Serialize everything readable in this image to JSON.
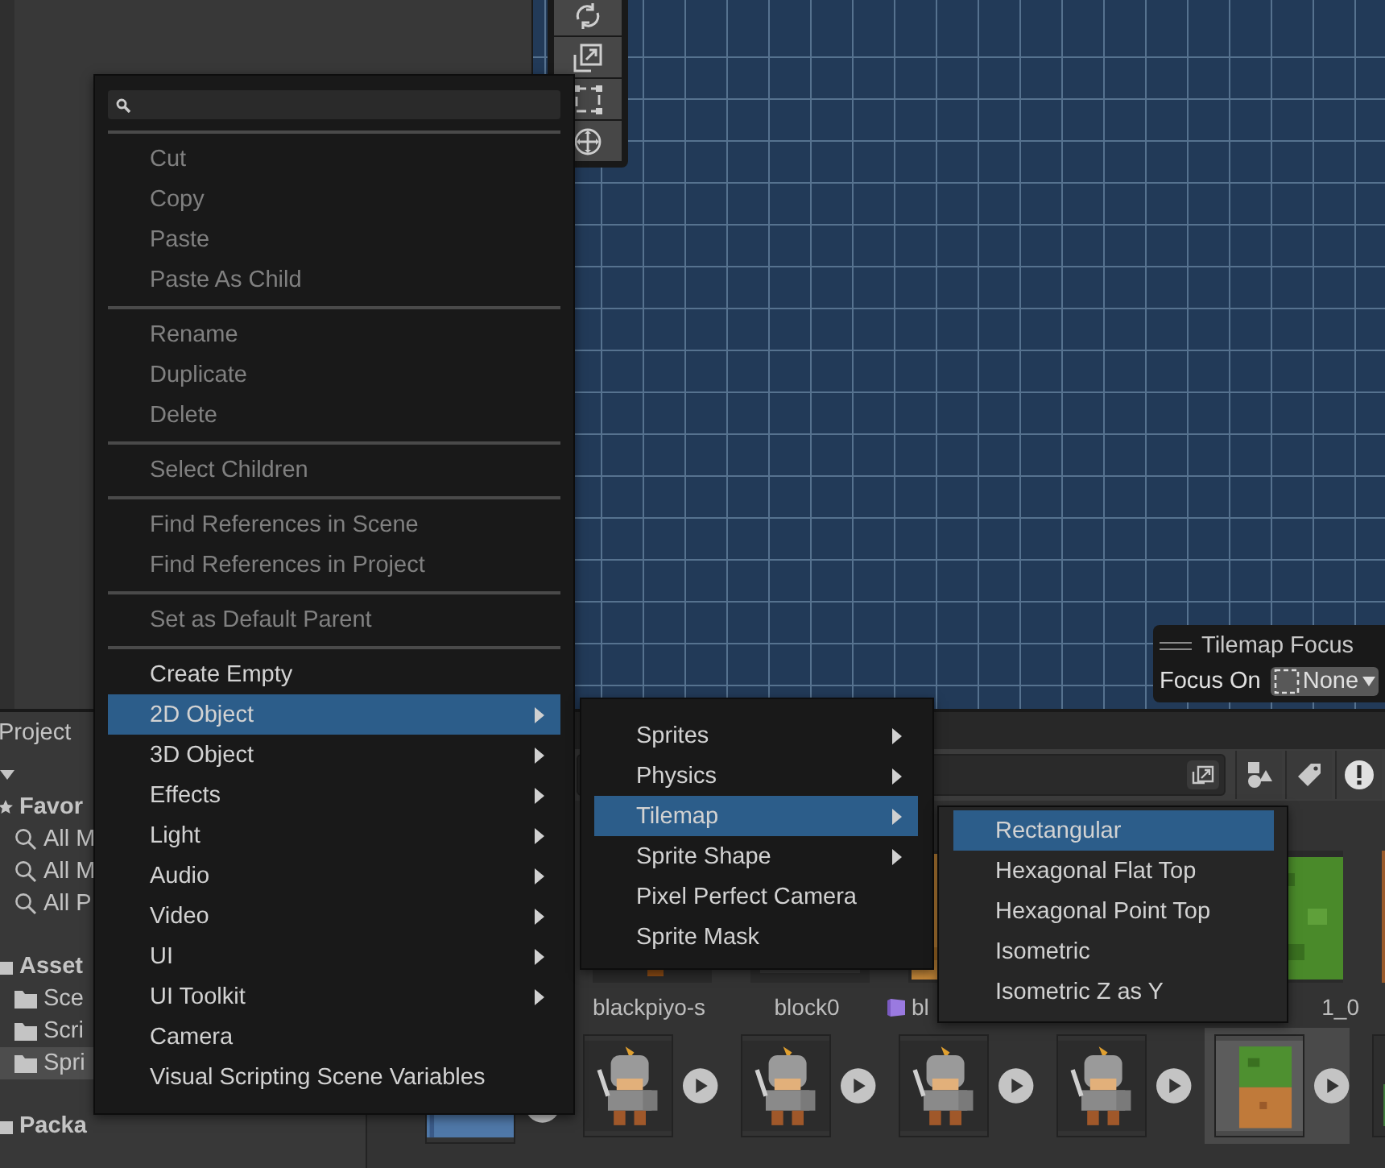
{
  "tilemap_focus": {
    "title": "Tilemap Focus",
    "label": "Focus On",
    "value": "None"
  },
  "project_panel": {
    "title": "Project",
    "tree": [
      {
        "label": "Favor",
        "kind": "favorites",
        "selected": false,
        "children": [
          {
            "label": "All M",
            "kind": "search",
            "selected": false
          },
          {
            "label": "All M",
            "kind": "search",
            "selected": false
          },
          {
            "label": "All P",
            "kind": "search",
            "selected": false
          }
        ]
      },
      {
        "label": "Asset",
        "kind": "folder",
        "selected": false,
        "children": [
          {
            "label": "Sce",
            "kind": "folder",
            "selected": false
          },
          {
            "label": "Scri",
            "kind": "folder",
            "selected": false
          },
          {
            "label": "Spri",
            "kind": "folder",
            "selected": true
          }
        ]
      },
      {
        "label": "Packa",
        "kind": "folder",
        "selected": false
      }
    ],
    "assets_row_1": [
      {
        "label": "blackpiyo-s",
        "kind": "sprite"
      },
      {
        "label": "block0",
        "kind": "sprite"
      },
      {
        "label": "bl",
        "kind": "prefab"
      },
      {
        "label": "1_0",
        "kind": "sprite"
      }
    ],
    "assets_row_2": [
      {
        "selected": false
      },
      {
        "selected": false
      },
      {
        "selected": false
      },
      {
        "selected": false
      },
      {
        "selected": false
      },
      {
        "selected": true
      },
      {
        "selected": false
      }
    ]
  },
  "context_menu": {
    "groups": [
      [
        {
          "label": "Cut",
          "disabled": true,
          "submenu": false,
          "selected": false
        },
        {
          "label": "Copy",
          "disabled": true,
          "submenu": false,
          "selected": false
        },
        {
          "label": "Paste",
          "disabled": true,
          "submenu": false,
          "selected": false
        },
        {
          "label": "Paste As Child",
          "disabled": true,
          "submenu": false,
          "selected": false
        }
      ],
      [
        {
          "label": "Rename",
          "disabled": true,
          "submenu": false,
          "selected": false
        },
        {
          "label": "Duplicate",
          "disabled": true,
          "submenu": false,
          "selected": false
        },
        {
          "label": "Delete",
          "disabled": true,
          "submenu": false,
          "selected": false
        }
      ],
      [
        {
          "label": "Select Children",
          "disabled": true,
          "submenu": false,
          "selected": false
        }
      ],
      [
        {
          "label": "Find References in Scene",
          "disabled": true,
          "submenu": false,
          "selected": false
        },
        {
          "label": "Find References in Project",
          "disabled": true,
          "submenu": false,
          "selected": false
        }
      ],
      [
        {
          "label": "Set as Default Parent",
          "disabled": true,
          "submenu": false,
          "selected": false
        }
      ],
      [
        {
          "label": "Create Empty",
          "disabled": false,
          "submenu": false,
          "selected": false
        },
        {
          "label": "2D Object",
          "disabled": false,
          "submenu": true,
          "selected": true
        },
        {
          "label": "3D Object",
          "disabled": false,
          "submenu": true,
          "selected": false
        },
        {
          "label": "Effects",
          "disabled": false,
          "submenu": true,
          "selected": false
        },
        {
          "label": "Light",
          "disabled": false,
          "submenu": true,
          "selected": false
        },
        {
          "label": "Audio",
          "disabled": false,
          "submenu": true,
          "selected": false
        },
        {
          "label": "Video",
          "disabled": false,
          "submenu": true,
          "selected": false
        },
        {
          "label": "UI",
          "disabled": false,
          "submenu": true,
          "selected": false
        },
        {
          "label": "UI Toolkit",
          "disabled": false,
          "submenu": true,
          "selected": false
        },
        {
          "label": "Camera",
          "disabled": false,
          "submenu": false,
          "selected": false
        },
        {
          "label": "Visual Scripting Scene Variables",
          "disabled": false,
          "submenu": false,
          "selected": false
        }
      ]
    ]
  },
  "submenu_2d_object": [
    {
      "label": "Sprites",
      "submenu": true,
      "selected": false
    },
    {
      "label": "Physics",
      "submenu": true,
      "selected": false
    },
    {
      "label": "Tilemap",
      "submenu": true,
      "selected": true
    },
    {
      "label": "Sprite Shape",
      "submenu": true,
      "selected": false
    },
    {
      "label": "Pixel Perfect Camera",
      "submenu": false,
      "selected": false
    },
    {
      "label": "Sprite Mask",
      "submenu": false,
      "selected": false
    }
  ],
  "submenu_tilemap": [
    {
      "label": "Rectangular",
      "selected": true
    },
    {
      "label": "Hexagonal Flat Top",
      "selected": false
    },
    {
      "label": "Hexagonal Point Top",
      "selected": false
    },
    {
      "label": "Isometric",
      "selected": false
    },
    {
      "label": "Isometric Z as Y",
      "selected": false
    }
  ]
}
